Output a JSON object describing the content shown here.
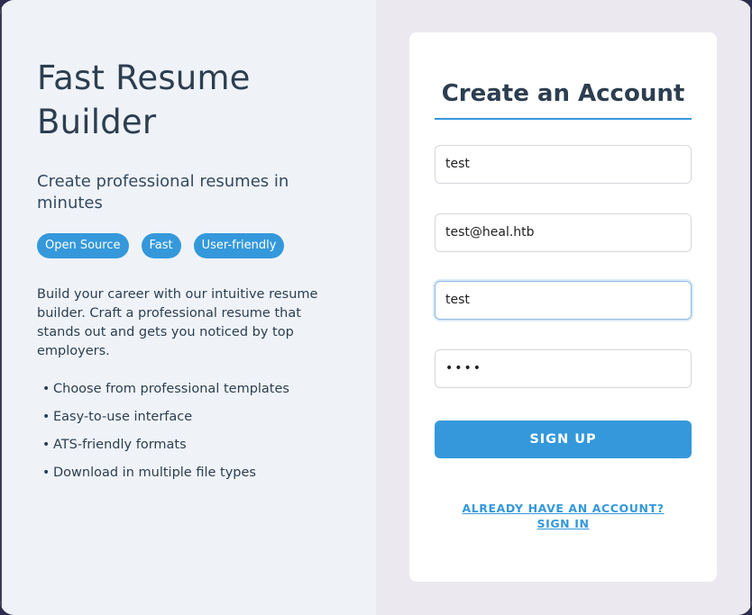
{
  "left": {
    "title_line1": "Fast Resume",
    "title_line2": "Builder",
    "tagline": "Create professional resumes in minutes",
    "badges": [
      "Open Source",
      "Fast",
      "User-friendly"
    ],
    "description": "Build your career with our intuitive resume builder. Craft a professional resume that stands out and gets you noticed by top employers.",
    "features": [
      "Choose from professional templates",
      "Easy-to-use interface",
      "ATS-friendly formats",
      "Download in multiple file types"
    ],
    "bullet": "•"
  },
  "form": {
    "title": "Create an Account",
    "fields": [
      {
        "name": "full-name",
        "value": "test"
      },
      {
        "name": "email",
        "value": "test@heal.htb"
      },
      {
        "name": "username",
        "value": "test"
      },
      {
        "name": "password",
        "value": "••••"
      }
    ],
    "signup_label": "SIGN UP",
    "signin_line1": "ALREADY HAVE AN ACCOUNT?",
    "signin_line2": "SIGN IN"
  },
  "colors": {
    "accent": "#3498db",
    "heading": "#2c3e50",
    "left_panel_bg": "#eff3f8",
    "right_panel_bg": "#ebe9ef"
  }
}
